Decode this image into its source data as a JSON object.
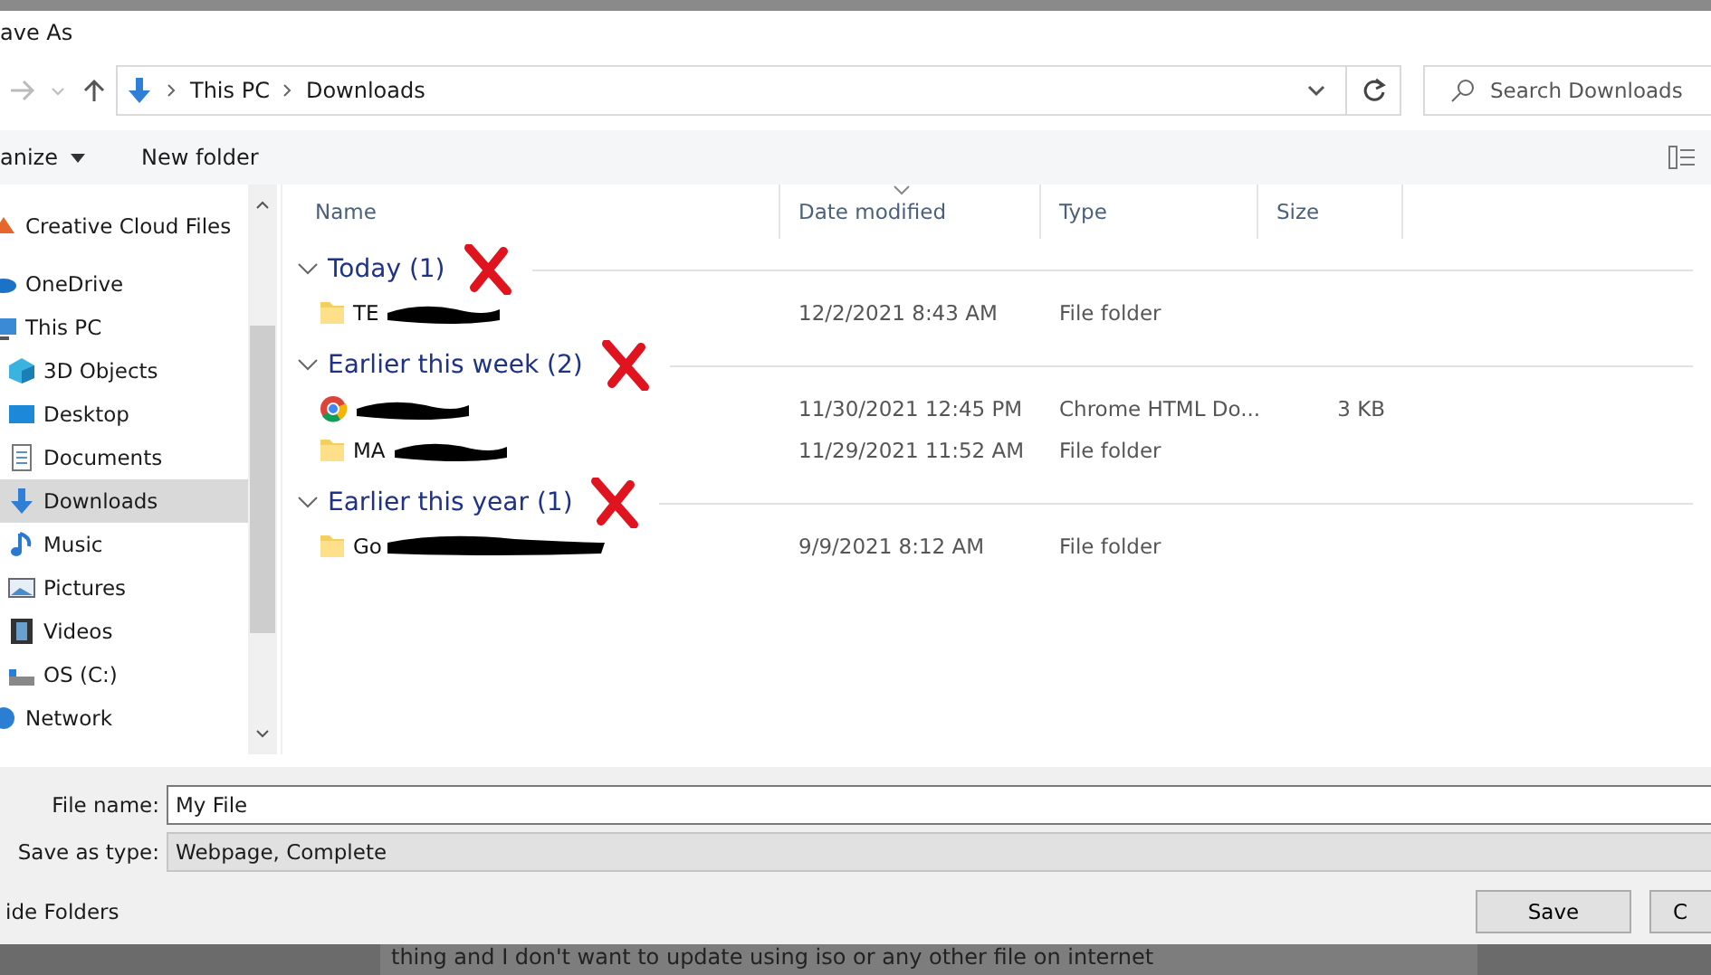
{
  "window": {
    "title": "ave As"
  },
  "address": {
    "path": [
      "This PC",
      "Downloads"
    ]
  },
  "search": {
    "placeholder": "Search Downloads"
  },
  "toolbar": {
    "organize": "anize",
    "new_folder": "New folder"
  },
  "sidebar": {
    "items": [
      {
        "label": "Creative Cloud Files",
        "selected": false
      },
      {
        "label": "OneDrive",
        "selected": false
      },
      {
        "label": "This PC",
        "selected": false,
        "children": [
          {
            "label": "3D Objects",
            "selected": false
          },
          {
            "label": "Desktop",
            "selected": false
          },
          {
            "label": "Documents",
            "selected": false
          },
          {
            "label": "Downloads",
            "selected": true
          },
          {
            "label": "Music",
            "selected": false
          },
          {
            "label": "Pictures",
            "selected": false
          },
          {
            "label": "Videos",
            "selected": false
          },
          {
            "label": "OS (C:)",
            "selected": false
          }
        ]
      },
      {
        "label": "Network",
        "selected": false
      }
    ]
  },
  "columns": [
    "Name",
    "Date modified",
    "Type",
    "Size"
  ],
  "groups": [
    {
      "title": "Today (1)",
      "expanded": true,
      "files": [
        {
          "name": "TE",
          "kind": "folder",
          "date": "12/2/2021 8:43 AM",
          "type": "File folder"
        }
      ]
    },
    {
      "title": "Earlier this week (2)",
      "expanded": true,
      "files": [
        {
          "kind": "html",
          "date": "11/30/2021 12:45 PM",
          "type": "Chrome HTML Do...",
          "size": "3 KB"
        },
        {
          "name": "MA",
          "kind": "folder",
          "date": "11/29/2021 11:52 AM",
          "type": "File folder"
        }
      ]
    },
    {
      "title": "Earlier this year (1)",
      "expanded": true,
      "files": [
        {
          "name": "Go",
          "kind": "folder",
          "date": "9/9/2021 8:12 AM",
          "type": "File folder"
        }
      ]
    }
  ],
  "file_name": {
    "label": "File name:",
    "value": "My File"
  },
  "save_type": {
    "label": "Save as type:",
    "value": "Webpage, Complete"
  },
  "hide_folders": "ide Folders",
  "buttons": [
    "Save",
    "C"
  ],
  "background_text": "thing and I don't want to update using iso or any other file on internet"
}
